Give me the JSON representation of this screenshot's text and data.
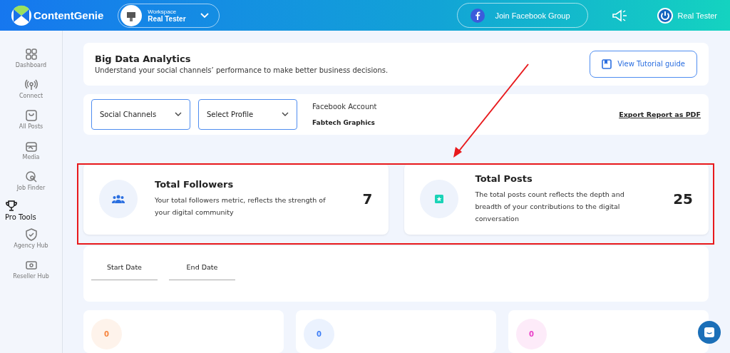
{
  "header": {
    "brand": "ContentGenie",
    "workspace": {
      "label": "Workspace",
      "name": "Real Tester"
    },
    "facebook_button": "Join Facebook Group",
    "user": "Real Tester"
  },
  "sidebar": {
    "items": [
      {
        "kind": "nav",
        "label": "Dashboard"
      },
      {
        "kind": "nav",
        "label": "Connect"
      },
      {
        "kind": "nav",
        "label": "All Posts"
      },
      {
        "kind": "nav",
        "label": "Media"
      },
      {
        "kind": "nav",
        "label": "Job Finder"
      },
      {
        "kind": "section",
        "label": "Pro Tools"
      },
      {
        "kind": "nav",
        "label": "Agency Hub"
      },
      {
        "kind": "nav",
        "label": "Reseller Hub"
      }
    ]
  },
  "intro": {
    "title": "Big Data Analytics",
    "subtitle": "Understand your social channels’ performance to make better business decisions.",
    "tutorial_button": "View Tutorial guide"
  },
  "filters": {
    "dropdowns": [
      "Social Channels",
      "Select Profile"
    ],
    "account_label": "Facebook Account",
    "account_name": "Fabtech Graphics",
    "export_link": "Export Report as PDF"
  },
  "summary_cards": [
    {
      "title": "Total Followers",
      "description": "Your total followers metric, reflects the strength of your digital community",
      "value": "7"
    },
    {
      "title": "Total Posts",
      "description": "The total posts count reflects the depth and breadth of your contributions to the digital conversation",
      "value": "25"
    }
  ],
  "date_range": {
    "fields": [
      {
        "placeholder": "Start Date"
      },
      {
        "placeholder": "End Date"
      }
    ]
  },
  "stat_cards": [
    {
      "value": "0",
      "color": "#f7853f"
    },
    {
      "value": "0",
      "color": "#3f7ff7"
    },
    {
      "value": "0",
      "color": "#e93fc7"
    }
  ]
}
